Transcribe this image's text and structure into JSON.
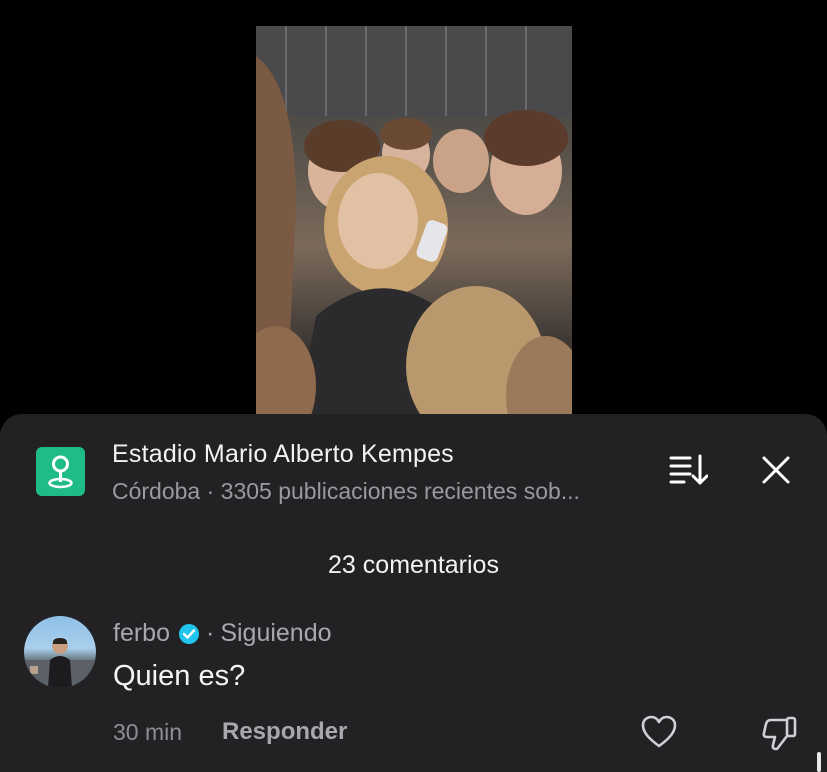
{
  "video": {
    "thumbnail_icon": "video-thumbnail"
  },
  "sheet": {
    "place": {
      "icon": "location-pin-icon",
      "title": "Estadio Mario Alberto Kempes",
      "subtitle": "Córdoba · 3305 publicaciones recientes sob..."
    },
    "sort_icon": "sort-icon",
    "close_icon": "close-icon",
    "comment_count": "23 comentarios",
    "comments": [
      {
        "username": "ferbo",
        "verified_icon": "verified-badge-icon",
        "separator": "·",
        "status": "Siguiendo",
        "text": "Quien es?",
        "time": "30 min",
        "reply_label": "Responder",
        "like_icon": "heart-icon",
        "dislike_icon": "dislike-icon"
      }
    ]
  },
  "colors": {
    "background": "#000000",
    "sheet": "#222224",
    "place_icon": "#1fbc8a",
    "verified": "#20c4ec",
    "muted_text": "#a8a8ac"
  }
}
